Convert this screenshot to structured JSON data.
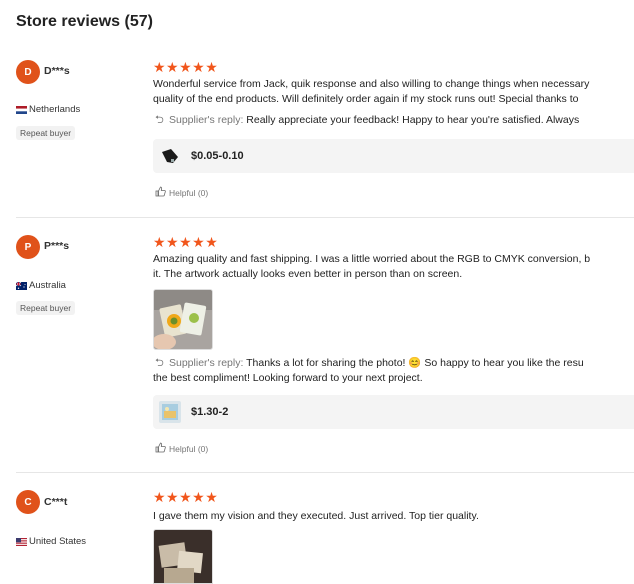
{
  "page": {
    "title": "Store reviews (57)"
  },
  "reviews": [
    {
      "avatar_initial": "D",
      "name": "D***s",
      "country": "Netherlands",
      "badge": "Repeat buyer",
      "stars": "★★★★★",
      "text_line1": "Wonderful service from Jack, quik response and also willing to change things when necessary",
      "text_line2": "quality of the end products. Will definitely order again if my stock runs out!  Special thanks to",
      "reply_label": "Supplier's reply:",
      "reply_text": " Really appreciate your feedback! Happy to hear you're satisfied. Always",
      "price": "$0.05-0.10",
      "helpful": "Helpful (0)"
    },
    {
      "avatar_initial": "P",
      "name": "P***s",
      "country": "Australia",
      "badge": "Repeat buyer",
      "stars": "★★★★★",
      "text_line1": "Amazing quality and fast shipping. I was a little worried about the RGB to CMYK conversion, b",
      "text_line2": "it. The artwork actually looks even better in person than on screen.",
      "reply_label": "Supplier's reply:",
      "reply_text": " Thanks a lot for sharing the photo! 😊 So happy to hear you like the resu",
      "reply_line2": "the best compliment! Looking forward to your next project.",
      "price": "$1.30-2",
      "helpful": "Helpful (0)"
    },
    {
      "avatar_initial": "C",
      "name": "C***t",
      "country": "United States",
      "stars": "★★★★★",
      "text_line1": "I gave them my vision and they executed. Just arrived. Top tier quality."
    }
  ],
  "colors": {
    "accent": "#f1561c",
    "avatar": "#e0521a"
  },
  "icons": {
    "reply": "reply-arrow-icon",
    "helpful": "thumbs-up-icon"
  }
}
